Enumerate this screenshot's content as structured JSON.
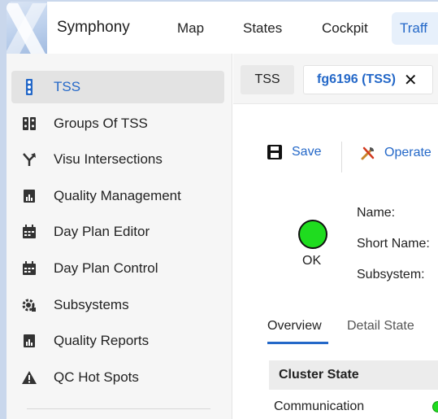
{
  "topbar": {
    "brand": "Symphony",
    "nav": [
      "Map",
      "States",
      "Cockpit"
    ],
    "nav_active": "Traff"
  },
  "sidebar": {
    "items": [
      {
        "label": "TSS",
        "icon": "traffic-light-icon",
        "active": true
      },
      {
        "label": "Groups Of TSS",
        "icon": "traffic-lights-group-icon",
        "active": false
      },
      {
        "label": "Visu Intersections",
        "icon": "intersection-arrows-icon",
        "active": false
      },
      {
        "label": "Quality Management",
        "icon": "chart-document-icon",
        "active": false
      },
      {
        "label": "Day Plan Editor",
        "icon": "calendar-icon",
        "active": false
      },
      {
        "label": "Day Plan Control",
        "icon": "calendar-icon",
        "active": false
      },
      {
        "label": "Subsystems",
        "icon": "gear-icon",
        "active": false
      },
      {
        "label": "Quality Reports",
        "icon": "chart-document-icon",
        "active": false
      },
      {
        "label": "QC Hot Spots",
        "icon": "warning-icon",
        "active": false
      }
    ]
  },
  "tabs": {
    "tab1": "TSS",
    "tab2": "fg6196 (TSS)",
    "close": "✕"
  },
  "toolbar": {
    "save": "Save",
    "operate": "Operate"
  },
  "status": {
    "text": "OK",
    "color": "#1fdc1f"
  },
  "fields": {
    "name": "Name:",
    "short_name": "Short Name:",
    "subsystem": "Subsystem:"
  },
  "subtabs": {
    "overview": "Overview",
    "detail_state": "Detail State"
  },
  "cluster": {
    "header": "Cluster State",
    "communication": "Communication"
  },
  "colors": {
    "accent": "#2468c8",
    "ok": "#1fdc1f"
  }
}
